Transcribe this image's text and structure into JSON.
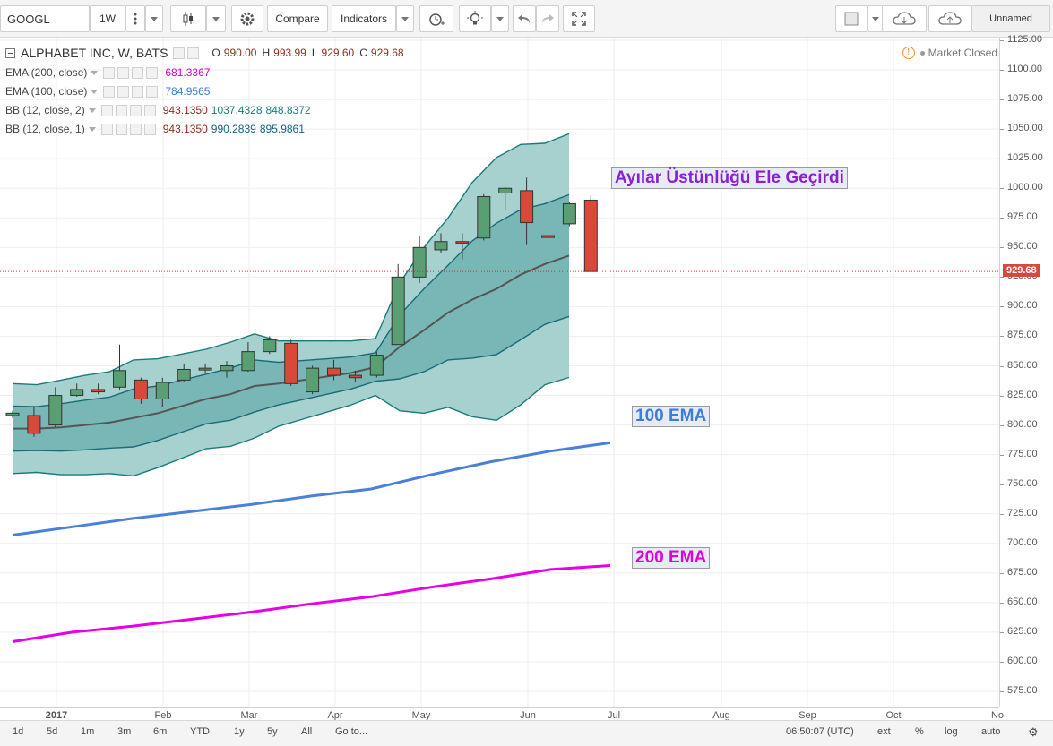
{
  "toolbar": {
    "symbol": "GOOGL",
    "interval": "1W",
    "compare_label": "Compare",
    "indicators_label": "Indicators",
    "layout_name": "Unnamed"
  },
  "legend": {
    "title": "ALPHABET INC, W, BATS",
    "ohlc": {
      "o_label": "O",
      "o": "990.00",
      "h_label": "H",
      "h": "993.99",
      "l_label": "L",
      "l": "929.60",
      "c_label": "C",
      "c": "929.68"
    },
    "market_status": "Market Closed",
    "indicators": [
      {
        "name": "EMA (200, close)",
        "values": [
          "681.3367"
        ],
        "colors": [
          "#cc00cc"
        ]
      },
      {
        "name": "EMA (100, close)",
        "values": [
          "784.9565"
        ],
        "colors": [
          "#3b7dd8"
        ]
      },
      {
        "name": "BB (12, close, 2)",
        "values": [
          "943.1350",
          "1037.4328",
          "848.8372"
        ],
        "colors": [
          "#8b2d1e",
          "#1a7a7a",
          "#1a7a7a"
        ]
      },
      {
        "name": "BB (12, close, 1)",
        "values": [
          "943.1350",
          "990.2839",
          "895.9861"
        ],
        "colors": [
          "#8b2d1e",
          "#1a5e7a",
          "#1a5e7a"
        ]
      }
    ]
  },
  "annotations": {
    "bears": "Ayılar Üstünlüğü Ele Geçirdi",
    "ema100": "100 EMA",
    "ema200": "200 EMA"
  },
  "price_label": "929.68",
  "price_axis": [
    "1125.00",
    "1100.00",
    "1075.00",
    "1050.00",
    "1025.00",
    "1000.00",
    "975.00",
    "950.00",
    "925.00",
    "900.00",
    "875.00",
    "850.00",
    "825.00",
    "800.00",
    "775.00",
    "750.00",
    "725.00",
    "700.00",
    "675.00",
    "650.00",
    "625.00",
    "600.00",
    "575.00"
  ],
  "time_axis": [
    "2017",
    "Feb",
    "Mar",
    "Apr",
    "May",
    "Jun",
    "Jul",
    "Aug",
    "Sep",
    "Oct",
    "No"
  ],
  "bottom_bar": {
    "ranges": [
      "1d",
      "5d",
      "1m",
      "3m",
      "6m",
      "YTD",
      "1y",
      "5y",
      "All"
    ],
    "goto": "Go to...",
    "clock": "06:50:07 (UTC)",
    "options": [
      "ext",
      "%",
      "log",
      "auto"
    ]
  },
  "chart_data": {
    "type": "candlestick",
    "title": "ALPHABET INC, W, BATS",
    "ylim": [
      565,
      1130
    ],
    "candles": [
      {
        "x": "2016-12-26",
        "o": 808,
        "h": 812,
        "l": 806,
        "c": 810
      },
      {
        "x": "2017-01-02",
        "o": 808,
        "h": 815,
        "l": 790,
        "c": 793
      },
      {
        "x": "2017-01-09",
        "o": 800,
        "h": 832,
        "l": 798,
        "c": 825
      },
      {
        "x": "2017-01-16",
        "o": 825,
        "h": 835,
        "l": 824,
        "c": 830
      },
      {
        "x": "2017-01-23",
        "o": 830,
        "h": 835,
        "l": 826,
        "c": 828
      },
      {
        "x": "2017-01-30",
        "o": 832,
        "h": 868,
        "l": 830,
        "c": 846
      },
      {
        "x": "2017-02-06",
        "o": 838,
        "h": 840,
        "l": 818,
        "c": 822
      },
      {
        "x": "2017-02-13",
        "o": 822,
        "h": 840,
        "l": 815,
        "c": 836
      },
      {
        "x": "2017-02-20",
        "o": 838,
        "h": 852,
        "l": 836,
        "c": 847
      },
      {
        "x": "2017-02-27",
        "o": 847,
        "h": 852,
        "l": 844,
        "c": 848
      },
      {
        "x": "2017-03-06",
        "o": 846,
        "h": 854,
        "l": 840,
        "c": 850
      },
      {
        "x": "2017-03-13",
        "o": 846,
        "h": 870,
        "l": 845,
        "c": 862
      },
      {
        "x": "2017-03-20",
        "o": 862,
        "h": 875,
        "l": 860,
        "c": 872
      },
      {
        "x": "2017-03-27",
        "o": 869,
        "h": 872,
        "l": 833,
        "c": 835
      },
      {
        "x": "2017-04-03",
        "o": 828,
        "h": 850,
        "l": 826,
        "c": 848
      },
      {
        "x": "2017-04-10",
        "o": 848,
        "h": 855,
        "l": 838,
        "c": 842
      },
      {
        "x": "2017-04-17",
        "o": 842,
        "h": 846,
        "l": 836,
        "c": 840
      },
      {
        "x": "2017-04-24",
        "o": 842,
        "h": 862,
        "l": 840,
        "c": 859
      },
      {
        "x": "2017-05-01",
        "o": 868,
        "h": 936,
        "l": 868,
        "c": 925
      },
      {
        "x": "2017-05-08",
        "o": 925,
        "h": 960,
        "l": 920,
        "c": 950
      },
      {
        "x": "2017-05-15",
        "o": 948,
        "h": 962,
        "l": 945,
        "c": 955
      },
      {
        "x": "2017-05-22",
        "o": 955,
        "h": 962,
        "l": 940,
        "c": 954
      },
      {
        "x": "2017-05-29",
        "o": 958,
        "h": 995,
        "l": 956,
        "c": 993
      },
      {
        "x": "2017-06-05",
        "o": 996,
        "h": 1001,
        "l": 982,
        "c": 1000
      },
      {
        "x": "2017-06-12",
        "o": 998,
        "h": 1009,
        "l": 952,
        "c": 971
      },
      {
        "x": "2017-06-19",
        "o": 960,
        "h": 970,
        "l": 936,
        "c": 959
      },
      {
        "x": "2017-06-26",
        "o": 970,
        "h": 988,
        "l": 968,
        "c": 987
      },
      {
        "x": "2017-07-03",
        "o": 990,
        "h": 993.99,
        "l": 929.6,
        "c": 929.68
      }
    ],
    "bb_12_2": {
      "upper": [
        835,
        834,
        838,
        842,
        845,
        855,
        856,
        860,
        864,
        870,
        877,
        871,
        871,
        871,
        871,
        873,
        920,
        950,
        975,
        1005,
        1026,
        1037,
        1038,
        1046,
        1038.4
      ],
      "middle": [
        797,
        797,
        798,
        800,
        802,
        806,
        810,
        816,
        822,
        826,
        833,
        835,
        838,
        841,
        844,
        849,
        866,
        880,
        895,
        906,
        915,
        927,
        936,
        943.1
      ]
    },
    "ema200": [
      617,
      625,
      630,
      636,
      642,
      649,
      655,
      663,
      670,
      678,
      681.3
    ],
    "ema100": [
      707,
      714,
      721,
      727,
      733,
      740,
      746,
      758,
      769,
      778,
      785
    ]
  }
}
